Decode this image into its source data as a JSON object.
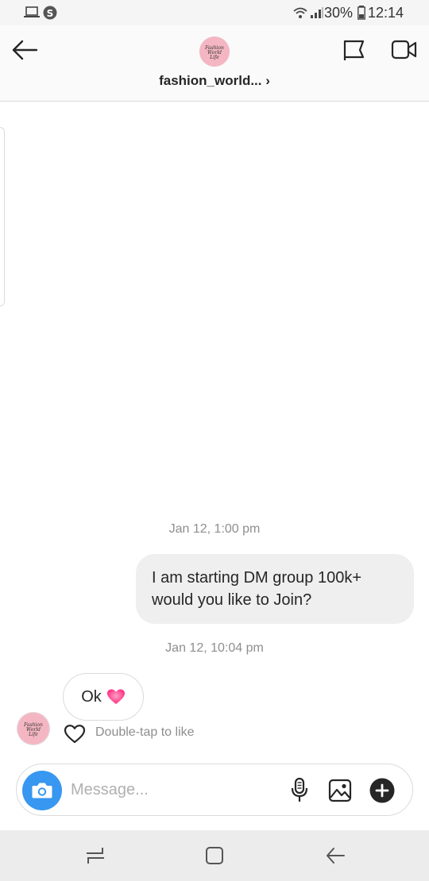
{
  "status_bar": {
    "battery_percent": "30%",
    "time": "12:14"
  },
  "header": {
    "username": "fashion_world... ›",
    "avatar_text": "Fashion World Life"
  },
  "chat": {
    "timestamp_1": "Jan 12, 1:00 pm",
    "outgoing_message": "I am starting DM group 100k+ would you like to Join?",
    "timestamp_2": "Jan 12, 10:04 pm",
    "incoming_message": "Ok",
    "like_hint": "Double-tap to like"
  },
  "composer": {
    "placeholder": "Message..."
  },
  "colors": {
    "camera_button": "#3897f0",
    "avatar_bg": "#f4b6c2",
    "heart": "#ff3d8b"
  }
}
